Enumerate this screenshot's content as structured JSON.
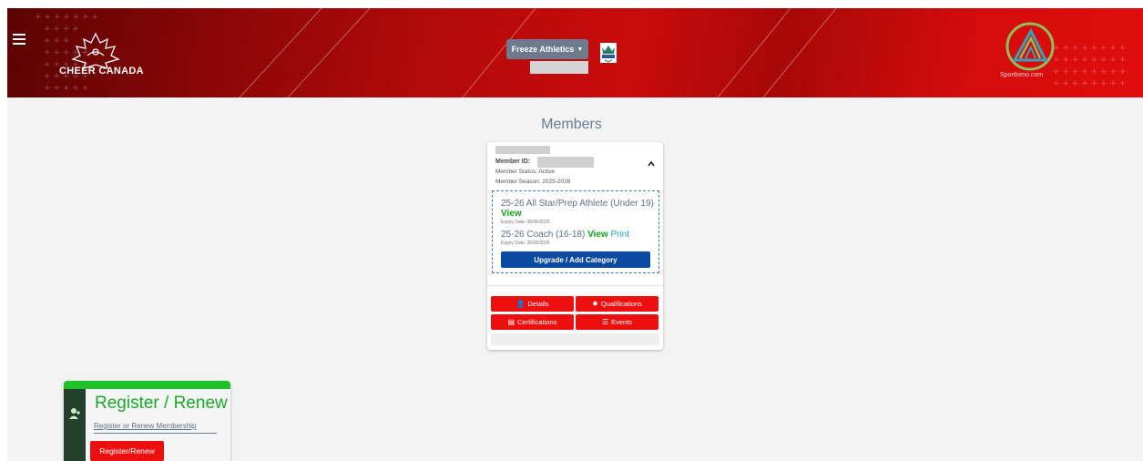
{
  "header": {
    "brand_name": "CHEER CANADA",
    "club_selector": {
      "label": "Freeze Athletics",
      "caret_icon": "caret-down-icon"
    },
    "club_logo_icon": "freeze-logo-icon",
    "partner_name": "Sportlomo.com",
    "menu_icon": "hamburger-menu-icon",
    "colors": {
      "banner_red": "#c90b0b",
      "banner_dark": "#5a0303"
    }
  },
  "members": {
    "title": "Members",
    "card": {
      "member_id_label": "Member ID:",
      "status": "Member Status: Active",
      "season": "Member Season: 2025-2026",
      "collapse_icon": "chevron-up-icon",
      "categories": [
        {
          "name": "25-26 All Star/Prep Athlete (Under 19)",
          "view": "View",
          "print": "",
          "expiry": "Expiry Date: 30/06/2026"
        },
        {
          "name": "25-26 Coach (16-18)",
          "view": "View",
          "print": "Print",
          "expiry": "Expiry Date: 30/06/2026"
        }
      ],
      "upgrade_label": "Upgrade / Add Category",
      "actions": [
        {
          "label": "Details",
          "icon": "user-icon"
        },
        {
          "label": "Qualifications",
          "icon": "badge-icon"
        },
        {
          "label": "Certifications",
          "icon": "certificate-icon"
        },
        {
          "label": "Events",
          "icon": "list-icon"
        }
      ],
      "colors": {
        "upgrade": "#0b4aa0",
        "action": "#ec0f0f",
        "view": "#16a11c",
        "print": "#1ea6c0"
      }
    }
  },
  "register": {
    "title": "Register / Renew",
    "link": "Register or Renew Membership",
    "button": "Register/Renew",
    "icon": "user-plus-icon",
    "colors": {
      "accent": "#1ec32a",
      "side": "#23402a"
    }
  }
}
